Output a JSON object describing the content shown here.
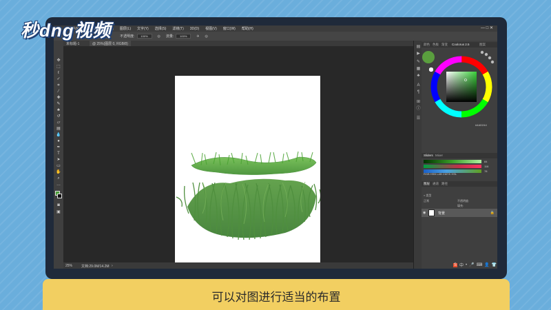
{
  "logo": {
    "text": "秒dng视频"
  },
  "caption": {
    "text": "可以对图进行适当的布置"
  },
  "photoshop": {
    "menu": [
      "文件(F)",
      "编辑(E)",
      "图像(I)",
      "图层(L)",
      "文字(Y)",
      "选择(S)",
      "滤镜(T)",
      "3D(D)",
      "视图(V)",
      "窗口(W)",
      "帮助(H)"
    ],
    "window_controls": "—  □  ✕",
    "options": {
      "mode_label": "正常",
      "opacity_label": "不透明度:",
      "opacity_value": "100%",
      "flow_label": "流量:",
      "flow_value": "100%"
    },
    "doc_tabs": [
      "未标题-1",
      "@ 25%(图层 0, RGB/8)"
    ],
    "status": {
      "zoom": "25%",
      "doc_info": "文档:29.0M/14.2M"
    },
    "right_panel": {
      "top_tabs": [
        "颜色",
        "色板",
        "渐变",
        "Coolorus 2.5",
        "图案"
      ],
      "hex": "#4AD244",
      "slider_tabs": [
        "Sliders",
        "Mixer"
      ],
      "rgb_label": "RGB HSB LAB CMYK HSL",
      "slider_values": [
        "84",
        "116",
        "78"
      ],
      "layers_tabs": [
        "图层",
        "通道",
        "路径"
      ],
      "layers_kind": "类型",
      "layers_mode": "正常",
      "layers_opacity": "不透明度:",
      "layers_fill": "填充:",
      "layer_name": "背景"
    }
  },
  "colors": {
    "accent_green": "#5a9e3e",
    "panel": "#3f3f3f",
    "caption_bg": "#f2cf61",
    "monitor": "#1f2a3a"
  }
}
